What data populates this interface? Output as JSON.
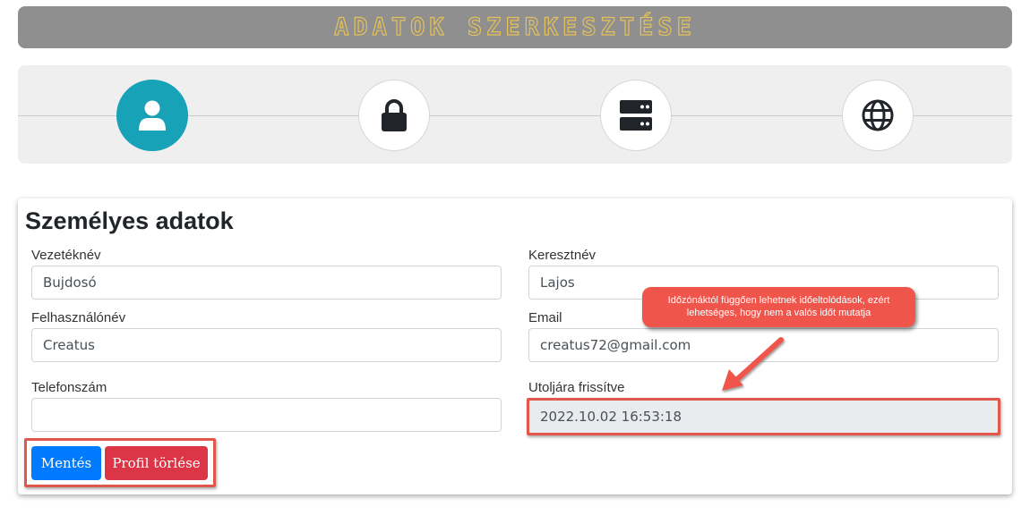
{
  "header": {
    "title": "ADATOK SZERKESZTÉSE"
  },
  "stepper": {
    "steps": [
      {
        "icon": "user-icon",
        "active": true
      },
      {
        "icon": "lock-icon",
        "active": false
      },
      {
        "icon": "server-icon",
        "active": false
      },
      {
        "icon": "globe-icon",
        "active": false
      }
    ]
  },
  "form": {
    "title": "Személyes adatok",
    "last_name": {
      "label": "Vezetéknév",
      "value": "Bujdosó"
    },
    "first_name": {
      "label": "Keresztnév",
      "value": "Lajos"
    },
    "username": {
      "label": "Felhasználónév",
      "value": "Creatus"
    },
    "email": {
      "label": "Email",
      "value": "creatus72@gmail.com"
    },
    "phone": {
      "label": "Telefonszám",
      "value": ""
    },
    "last_updated": {
      "label": "Utoljára frissítve",
      "value": "2022.10.02 16:53:18"
    },
    "save_label": "Mentés",
    "delete_label": "Profil törlése"
  },
  "annotation": {
    "text": "Időzónáktól függően lehetnek időeltolódások, ezért lehetséges, hogy nem a valós időt mutatja"
  },
  "colors": {
    "accent": "#17a2b8",
    "primary": "#007bff",
    "danger": "#dc3545",
    "highlight": "#e2574c",
    "title_text": "#e4c15a"
  }
}
